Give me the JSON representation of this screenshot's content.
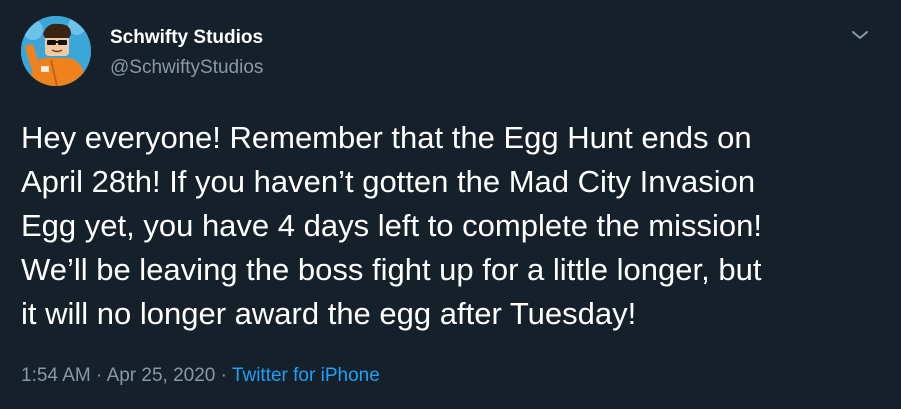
{
  "author": {
    "display_name": "Schwifty Studios",
    "handle": "@SchwiftyStudios",
    "avatar_icon": "roblox-character-avatar"
  },
  "menu": {
    "icon": "chevron-down-icon"
  },
  "tweet": {
    "text": "Hey everyone! Remember that the Egg Hunt ends on\nApril 28th! If you haven’t gotten the Mad City Invasion\nEgg yet, you have 4 days left to complete the mission!\nWe’ll be leaving the boss fight up for a little longer, but\nit will no longer award the egg after Tuesday!"
  },
  "meta": {
    "time": "1:54 AM",
    "separator": " · ",
    "date": "Apr 25, 2020",
    "source": "Twitter for iPhone"
  },
  "colors": {
    "background": "#15202b",
    "text_primary": "#ffffff",
    "text_secondary": "#8899a6",
    "link": "#1da1f2"
  }
}
